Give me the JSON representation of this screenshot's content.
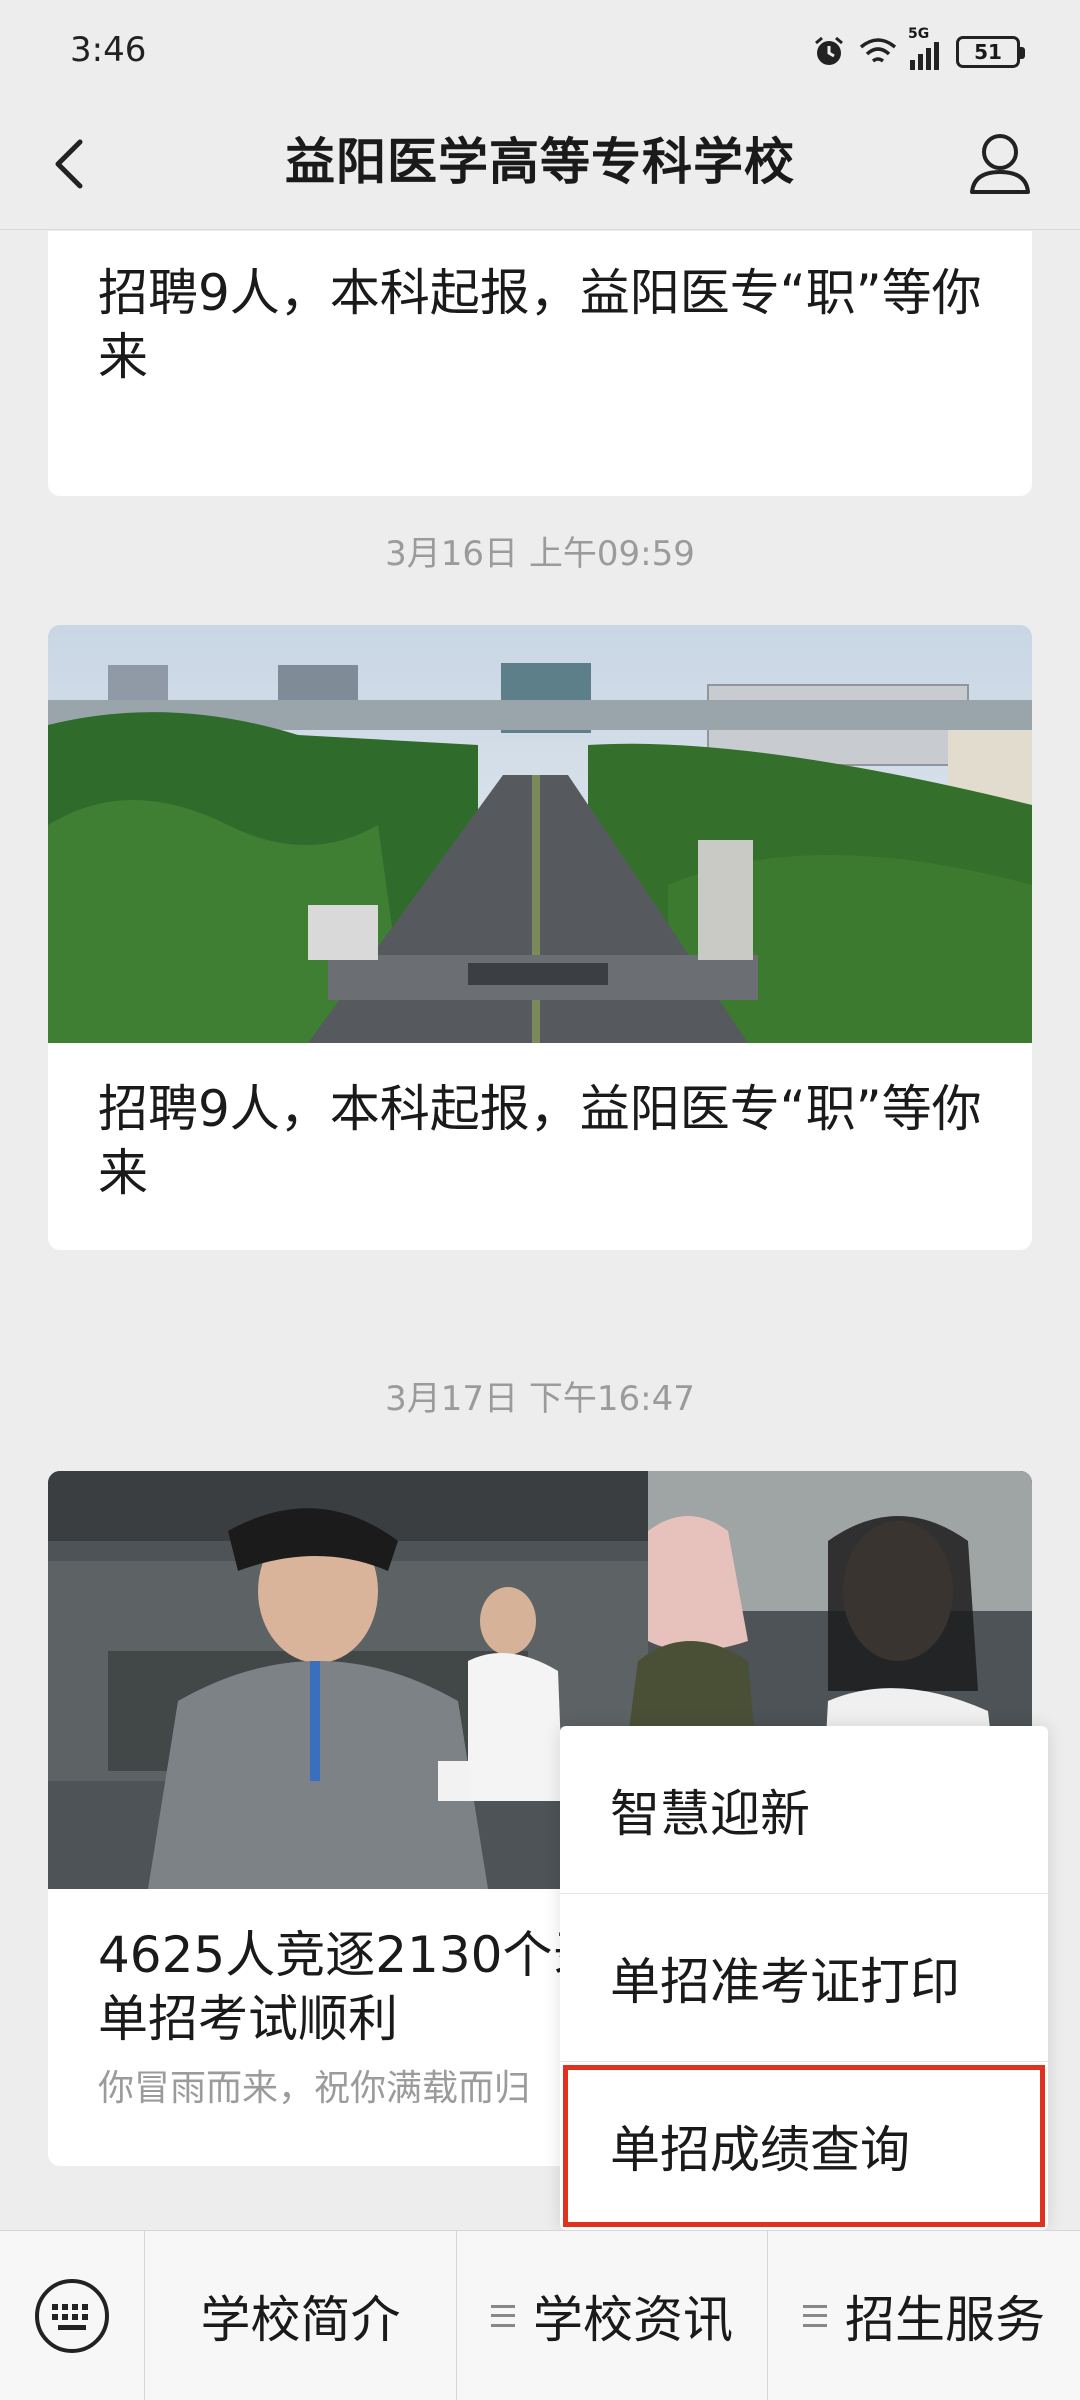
{
  "status_bar": {
    "time": "3:46",
    "network": "5G",
    "battery": "51"
  },
  "nav": {
    "title": "益阳医学高等专科学校",
    "back_icon": "chevron-left-icon",
    "profile_icon": "person-icon"
  },
  "feed": {
    "cards": [
      {
        "title": "招聘9人，本科起报，益阳医专“职”等你来"
      },
      {
        "timestamp": "3月16日 上午09:59",
        "title": "招聘9人，本科起报，益阳医专“职”等你来",
        "image": "campus-aerial-photo"
      },
      {
        "timestamp": "3月17日 下午16:47",
        "title": "4625人竞逐2130个录取名额 2024年单招考试顺利",
        "digest": "你冒雨而来，祝你满载而归",
        "image": "exam-registration-photo"
      }
    ]
  },
  "popup_menu": {
    "items": [
      {
        "label": "智慧迎新"
      },
      {
        "label": "单招准考证打印"
      },
      {
        "label": "单招成绩查询",
        "highlighted": true
      }
    ],
    "highlight_color": "#e0301e"
  },
  "bottom_menu": {
    "keyboard_icon": "keyboard-icon",
    "items": [
      {
        "label": "学校简介"
      },
      {
        "label": "学校资讯"
      },
      {
        "label": "招生服务"
      }
    ]
  }
}
